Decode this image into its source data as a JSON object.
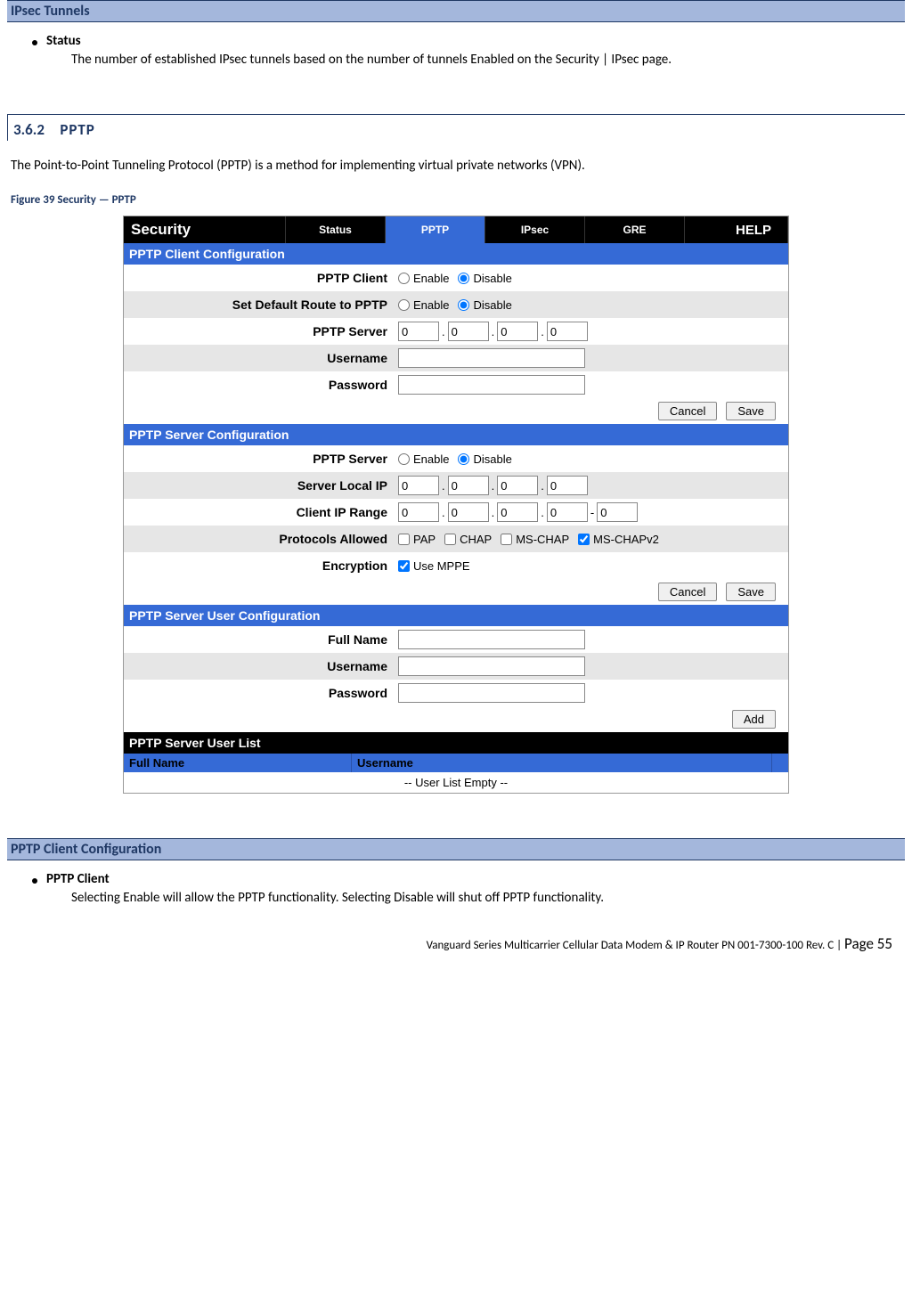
{
  "sections": {
    "ipsec_tunnels": {
      "heading": "IPsec Tunnels",
      "bullet_title": "Status",
      "bullet_body": "The number of established IPsec tunnels based on the number of tunnels Enabled on the Security | IPsec page."
    },
    "pptp_sub": {
      "num": "3.6.2",
      "title": "PPTP",
      "intro": "The Point-to-Point Tunneling Protocol (PPTP) is a method for implementing virtual private networks (VPN).",
      "fig_caption": "Figure 39 Security — PPTP"
    },
    "pptp_client_conf": {
      "heading": "PPTP Client Configuration",
      "bullet_title": "PPTP Client",
      "bullet_body": "Selecting Enable will allow the PPTP functionality. Selecting Disable will shut off PPTP functionality."
    }
  },
  "panel": {
    "tabs": {
      "main": "Security",
      "status": "Status",
      "pptp": "PPTP",
      "ipsec": "IPsec",
      "gre": "GRE",
      "help": "HELP"
    },
    "client": {
      "header": "PPTP Client Configuration",
      "rows": {
        "pptp_client": "PPTP Client",
        "default_route": "Set Default Route to PPTP",
        "server": "PPTP Server",
        "username": "Username",
        "password": "Password"
      },
      "server_ip": [
        "0",
        "0",
        "0",
        "0"
      ]
    },
    "server": {
      "header": "PPTP Server Configuration",
      "rows": {
        "pptp_server": "PPTP Server",
        "local_ip": "Server Local IP",
        "client_range": "Client IP Range",
        "protocols": "Protocols Allowed",
        "encryption": "Encryption"
      },
      "local_ip": [
        "0",
        "0",
        "0",
        "0"
      ],
      "range": [
        "0",
        "0",
        "0",
        "0",
        "0"
      ],
      "protocols": {
        "pap": "PAP",
        "chap": "CHAP",
        "mschap": "MS-CHAP",
        "mschapv2": "MS-CHAPv2"
      },
      "mppe": "Use MPPE"
    },
    "user": {
      "header": "PPTP Server User Configuration",
      "rows": {
        "fullname": "Full Name",
        "username": "Username",
        "password": "Password"
      }
    },
    "list": {
      "title": "PPTP Server User List",
      "col_full": "Full Name",
      "col_user": "Username",
      "empty": "-- User List Empty --"
    },
    "radio": {
      "enable": "Enable",
      "disable": "Disable"
    },
    "buttons": {
      "cancel": "Cancel",
      "save": "Save",
      "add": "Add"
    }
  },
  "footer": {
    "text": "Vanguard Series Multicarrier Cellular Data Modem & IP Router PN 001-7300-100 Rev. C",
    "sep": " | ",
    "page": "Page 55"
  }
}
